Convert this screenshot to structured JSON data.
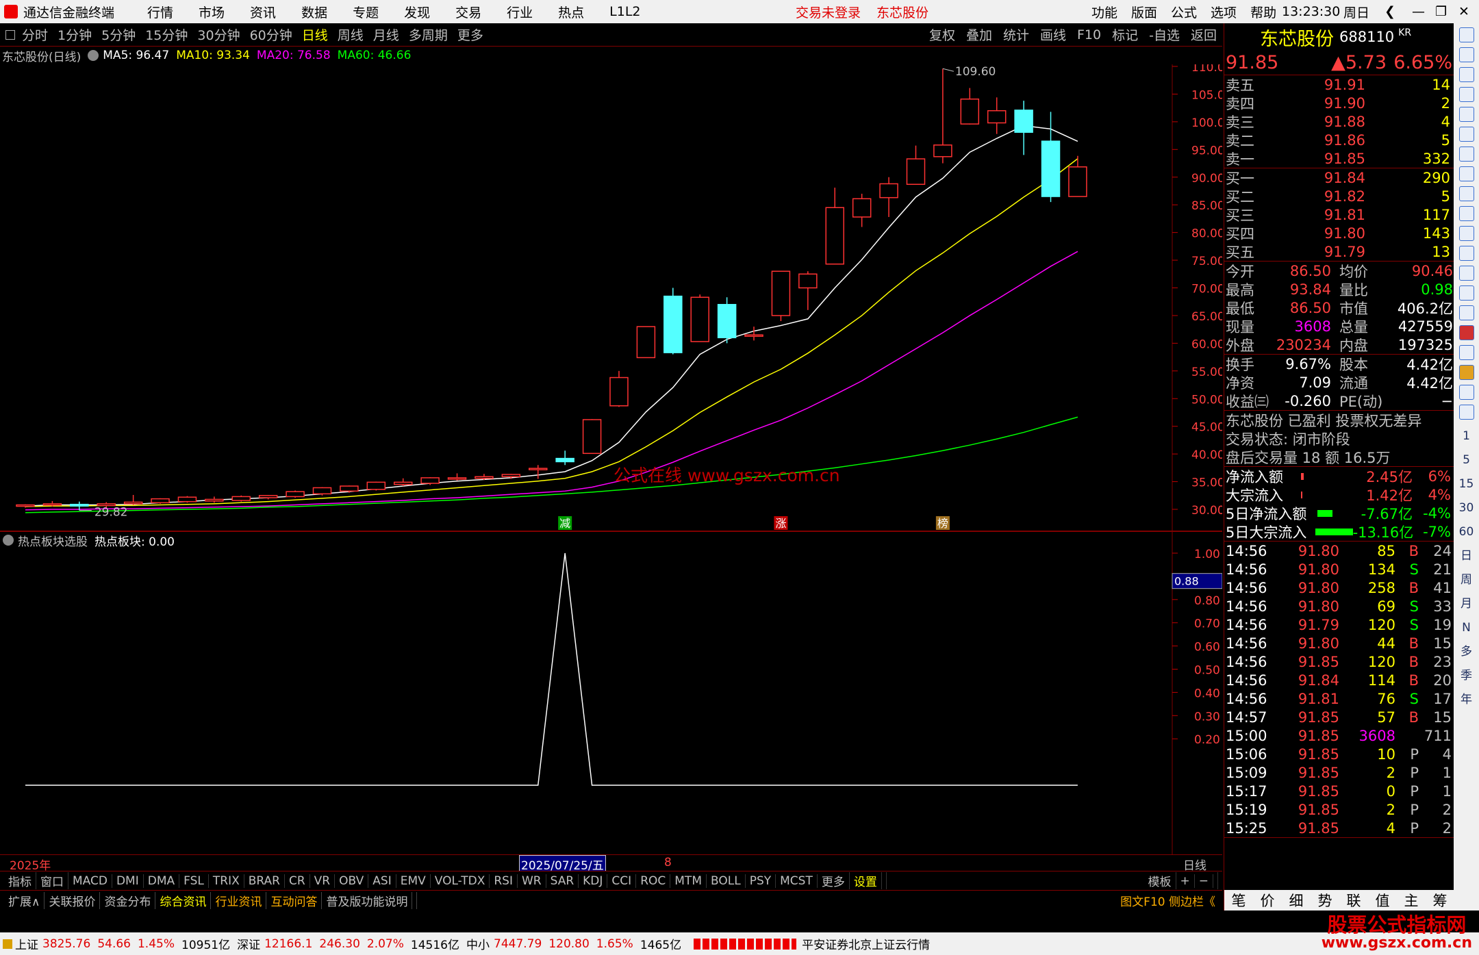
{
  "titlebar": {
    "app": "通达信金融终端",
    "menus": [
      "行情",
      "市场",
      "资讯",
      "数据",
      "专题",
      "发现",
      "交易",
      "行业",
      "热点",
      "L1L2"
    ],
    "notice": "交易未登录",
    "stock": "东芯股份",
    "right": [
      "功能",
      "版面",
      "公式",
      "选项",
      "帮助"
    ],
    "time": "13:23:30",
    "weekday": "周日"
  },
  "tabs": [
    "分时",
    "1分钟",
    "5分钟",
    "15分钟",
    "30分钟",
    "60分钟",
    "日线",
    "周线",
    "月线",
    "多周期",
    "更多"
  ],
  "active_tab": "日线",
  "tools": [
    "复权",
    "叠加",
    "统计",
    "画线",
    "F10",
    "标记",
    "-自选",
    "返回"
  ],
  "chart_title": "东芯股份(日线)",
  "ma": [
    {
      "label": "MA5: 96.47",
      "color": "#ffffff"
    },
    {
      "label": "MA10: 93.34",
      "color": "#ffff00"
    },
    {
      "label": "MA20: 76.58",
      "color": "#ff00ff"
    },
    {
      "label": "MA60: 46.66",
      "color": "#00ff00"
    }
  ],
  "watermark": "公式在线  www.gszx.com.cn",
  "chart_data": [
    {
      "type": "candlestick",
      "title": "东芯股份(日线)",
      "y_axis_ticks": [
        110.0,
        105.0,
        100.0,
        95.0,
        90.0,
        85.0,
        80.0,
        75.0,
        70.0,
        65.0,
        60.0,
        55.0,
        50.0,
        45.0,
        40.0,
        35.0,
        30.0
      ],
      "annotations": [
        {
          "text": "109.60",
          "kind": "high"
        },
        {
          "text": "29.82",
          "kind": "low"
        }
      ],
      "markers": [
        "减",
        "涨",
        "榜"
      ],
      "candles": [
        [
          30.6,
          30.9,
          30.3,
          30.8
        ],
        [
          30.8,
          31.5,
          30.5,
          31.0
        ],
        [
          30.9,
          31.4,
          29.82,
          30.6
        ],
        [
          30.7,
          31.3,
          30.3,
          31.0
        ],
        [
          31.0,
          32.6,
          30.8,
          31.3
        ],
        [
          31.2,
          32.0,
          31.0,
          31.9
        ],
        [
          31.4,
          32.4,
          31.2,
          32.2
        ],
        [
          31.5,
          32.3,
          31.2,
          31.8
        ],
        [
          31.6,
          32.5,
          31.4,
          32.3
        ],
        [
          32.1,
          32.6,
          31.8,
          32.5
        ],
        [
          32.3,
          33.4,
          32.1,
          33.2
        ],
        [
          32.8,
          34.0,
          32.5,
          33.9
        ],
        [
          33.3,
          34.3,
          33.0,
          34.2
        ],
        [
          33.6,
          35.0,
          33.4,
          34.9
        ],
        [
          34.5,
          35.6,
          34.2,
          34.9
        ],
        [
          34.7,
          35.8,
          34.4,
          35.7
        ],
        [
          35.5,
          36.5,
          35.2,
          35.7
        ],
        [
          35.6,
          36.4,
          35.3,
          35.9
        ],
        [
          35.9,
          36.4,
          35.5,
          36.3
        ],
        [
          37.2,
          38.0,
          35.5,
          37.4
        ],
        [
          39.2,
          40.6,
          38.0,
          38.6
        ],
        [
          40.1,
          46.3,
          40.1,
          46.2
        ],
        [
          48.7,
          55.0,
          48.5,
          53.8
        ],
        [
          57.4,
          63.0,
          57.4,
          63.0
        ],
        [
          68.5,
          70.0,
          58.0,
          58.3
        ],
        [
          60.3,
          68.8,
          60.3,
          68.3
        ],
        [
          67.0,
          68.3,
          60.0,
          61.0
        ],
        [
          61.3,
          63.0,
          60.5,
          61.5
        ],
        [
          65.0,
          73.0,
          64.0,
          73.0
        ],
        [
          70.0,
          73.0,
          66.0,
          72.5
        ],
        [
          74.3,
          88.1,
          74.3,
          84.5
        ],
        [
          82.8,
          87.0,
          81.0,
          86.1
        ],
        [
          86.3,
          90.0,
          82.8,
          88.8
        ],
        [
          88.7,
          95.7,
          88.7,
          93.3
        ],
        [
          93.7,
          109.6,
          92.5,
          95.8
        ],
        [
          99.6,
          106.1,
          99.5,
          104.1
        ],
        [
          99.8,
          104.4,
          97.8,
          102.0
        ],
        [
          102.1,
          103.8,
          94.0,
          98.1
        ],
        [
          96.5,
          101.8,
          85.5,
          86.5
        ],
        [
          86.5,
          93.84,
          86.5,
          91.85
        ]
      ],
      "series": [
        {
          "name": "MA5",
          "color": "#ffffff",
          "values": [
            30.6,
            30.8,
            30.8,
            30.8,
            30.9,
            31.2,
            31.4,
            31.7,
            31.9,
            32.1,
            32.4,
            32.8,
            33.2,
            33.7,
            34.2,
            34.7,
            35.1,
            35.4,
            35.7,
            36.2,
            36.8,
            38.8,
            42.1,
            47.6,
            52.0,
            58.0,
            60.7,
            62.2,
            63.2,
            64.4,
            70.0,
            75.1,
            80.9,
            86.4,
            89.8,
            94.5,
            97.0,
            99.3,
            98.7,
            96.47
          ]
        },
        {
          "name": "MA10",
          "color": "#ffff00",
          "values": [
            30.5,
            30.6,
            30.6,
            30.7,
            30.7,
            30.8,
            30.9,
            31.0,
            31.2,
            31.4,
            31.7,
            32.0,
            32.3,
            32.7,
            33.1,
            33.5,
            33.9,
            34.3,
            34.7,
            35.1,
            35.6,
            36.8,
            38.6,
            41.3,
            44.2,
            47.5,
            50.3,
            53.0,
            55.3,
            58.2,
            61.5,
            65.0,
            69.2,
            73.1,
            76.3,
            79.8,
            82.9,
            86.4,
            89.6,
            93.34
          ]
        },
        {
          "name": "MA20",
          "color": "#ff00ff",
          "values": [
            29.9,
            30.0,
            30.0,
            30.1,
            30.1,
            30.2,
            30.3,
            30.4,
            30.5,
            30.6,
            30.8,
            31.0,
            31.2,
            31.4,
            31.6,
            31.9,
            32.1,
            32.4,
            32.7,
            33.0,
            33.3,
            34.0,
            35.1,
            36.7,
            38.5,
            40.5,
            42.4,
            44.3,
            46.1,
            48.3,
            50.7,
            53.2,
            56.1,
            59.0,
            61.9,
            65.0,
            67.9,
            70.9,
            73.9,
            76.58
          ]
        },
        {
          "name": "MA60",
          "color": "#00ff00",
          "values": [
            29.4,
            29.5,
            29.6,
            29.7,
            29.8,
            29.9,
            30.0,
            30.1,
            30.2,
            30.4,
            30.5,
            30.7,
            30.9,
            31.1,
            31.3,
            31.5,
            31.7,
            32.0,
            32.2,
            32.5,
            32.8,
            33.1,
            33.5,
            33.9,
            34.3,
            34.8,
            35.3,
            35.8,
            36.3,
            36.9,
            37.5,
            38.2,
            38.9,
            39.7,
            40.6,
            41.6,
            42.7,
            43.9,
            45.3,
            46.66
          ]
        }
      ]
    },
    {
      "type": "line",
      "title": "热点板块选股",
      "series": [
        {
          "name": "热点板块",
          "values": [
            0,
            0,
            0,
            0,
            0,
            0,
            0,
            0,
            0,
            0,
            0,
            0,
            0,
            0,
            0,
            0,
            0,
            0,
            0,
            0,
            1,
            0,
            0,
            0,
            0,
            0,
            0,
            0,
            0,
            0,
            0,
            0,
            0,
            0,
            0,
            0,
            0,
            0,
            0,
            0
          ]
        }
      ],
      "y_axis_ticks": [
        1.0,
        0.8,
        0.7,
        0.6,
        0.5,
        0.4,
        0.3,
        0.2
      ],
      "cursor_value": "0.88"
    }
  ],
  "indicator": {
    "title": "热点板块选股",
    "value_label": "热点板块: 0.00"
  },
  "axis": {
    "year": "2025年",
    "date": "2025/07/25/五",
    "mark": "8",
    "period": "日线"
  },
  "indicator_tabs": [
    "指标",
    "窗口",
    "MACD",
    "DMI",
    "DMA",
    "FSL",
    "TRIX",
    "BRAR",
    "CR",
    "VR",
    "OBV",
    "ASI",
    "EMV",
    "VOL-TDX",
    "RSI",
    "WR",
    "SAR",
    "KDJ",
    "CCI",
    "ROC",
    "MTM",
    "BOLL",
    "PSY",
    "MCST",
    "更多",
    "设置"
  ],
  "indicator_right": [
    "模板",
    "+",
    "−"
  ],
  "bottom_tabs": [
    "扩展∧",
    "关联报价",
    "资金分布",
    "综合资讯",
    "行业资讯",
    "互动问答",
    "普及版功能说明"
  ],
  "bottom_right": "图文F10 侧边栏《",
  "panel_tabs": [
    "笔",
    "价",
    "细",
    "势",
    "联",
    "值",
    "主",
    "筹"
  ],
  "quote": {
    "name": "东芯股份",
    "code": "688110",
    "tag": "KR",
    "price": "91.85",
    "change": "▲5.73",
    "pct": "6.65%"
  },
  "asks": [
    [
      "卖五",
      "91.91",
      "14"
    ],
    [
      "卖四",
      "91.90",
      "2"
    ],
    [
      "卖三",
      "91.88",
      "4"
    ],
    [
      "卖二",
      "91.86",
      "5"
    ],
    [
      "卖一",
      "91.85",
      "332"
    ]
  ],
  "bids": [
    [
      "买一",
      "91.84",
      "290"
    ],
    [
      "买二",
      "91.82",
      "5"
    ],
    [
      "买三",
      "91.81",
      "117"
    ],
    [
      "买四",
      "91.80",
      "143"
    ],
    [
      "买五",
      "91.79",
      "13"
    ]
  ],
  "stats": [
    [
      "今开",
      "86.50",
      "均价",
      "90.46"
    ],
    [
      "最高",
      "93.84",
      "量比",
      "0.98"
    ],
    [
      "最低",
      "86.50",
      "市值",
      "406.2亿"
    ],
    [
      "现量",
      "3608",
      "总量",
      "427559"
    ],
    [
      "外盘",
      "230234",
      "内盘",
      "197325"
    ]
  ],
  "stats2": [
    [
      "换手",
      "9.67%",
      "股本",
      "4.42亿"
    ],
    [
      "净资",
      "7.09",
      "流通",
      "4.42亿"
    ],
    [
      "收益㈢",
      "-0.260",
      "PE(动)",
      "−"
    ]
  ],
  "info": [
    "东芯股份 已盈利 投票权无差异",
    "交易状态: 闭市阶段",
    "盘后交易量 18 额 16.5万"
  ],
  "flows": [
    [
      "净流入额",
      "2.45亿",
      "6%"
    ],
    [
      "大宗流入",
      "1.42亿",
      "4%"
    ],
    [
      "5日净流入额",
      "-7.67亿",
      "-4%"
    ],
    [
      "5日大宗流入",
      "-13.16亿",
      "-7%"
    ]
  ],
  "ticks": [
    [
      "14:56",
      "91.80",
      "85",
      "B",
      "24"
    ],
    [
      "14:56",
      "91.80",
      "134",
      "S",
      "21"
    ],
    [
      "14:56",
      "91.80",
      "258",
      "B",
      "41"
    ],
    [
      "14:56",
      "91.80",
      "69",
      "S",
      "33"
    ],
    [
      "14:56",
      "91.79",
      "120",
      "S",
      "19"
    ],
    [
      "14:56",
      "91.80",
      "44",
      "B",
      "15"
    ],
    [
      "14:56",
      "91.85",
      "120",
      "B",
      "23"
    ],
    [
      "14:56",
      "91.84",
      "114",
      "B",
      "20"
    ],
    [
      "14:56",
      "91.81",
      "76",
      "S",
      "17"
    ],
    [
      "14:57",
      "91.85",
      "57",
      "B",
      "15"
    ],
    [
      "15:00",
      "91.85",
      "3608",
      "",
      "711"
    ],
    [
      "15:06",
      "91.85",
      "10",
      "P",
      "4"
    ],
    [
      "15:09",
      "91.85",
      "2",
      "P",
      "1"
    ],
    [
      "15:17",
      "91.85",
      "0",
      "P",
      "1"
    ],
    [
      "15:19",
      "91.85",
      "2",
      "P",
      "2"
    ],
    [
      "15:25",
      "91.85",
      "4",
      "P",
      "2"
    ]
  ],
  "sidebar": [
    "1",
    "5",
    "15",
    "30",
    "60",
    "日",
    "周",
    "月",
    "N",
    "多",
    "季",
    "年"
  ],
  "status": {
    "indices": [
      [
        "上证",
        "3825.76",
        "54.66",
        "1.45%",
        "10951亿"
      ],
      [
        "深证",
        "12166.1",
        "246.30",
        "2.07%",
        "14516亿"
      ],
      [
        "中小",
        "7447.79",
        "120.80",
        "1.65%",
        "1465亿"
      ]
    ],
    "broker": "平安证券北京上证云行情",
    "brand1": "股票公式指标网",
    "brand2": "www.gszx.com.cn"
  }
}
